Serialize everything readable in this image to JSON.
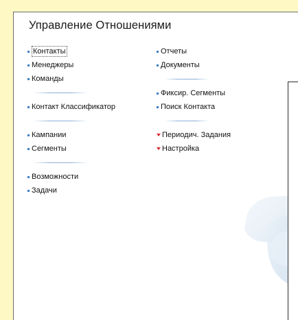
{
  "panel": {
    "title": "Управление Отношениями"
  },
  "left_column": {
    "group1": [
      "Контакты",
      "Менеджеры",
      "Команды"
    ],
    "group2": [
      "Контакт Классификатор"
    ],
    "group3": [
      "Кампании",
      "Сегменты"
    ],
    "group4": [
      "Возможности",
      "Задачи"
    ]
  },
  "right_column": {
    "group1": [
      "Отчеты",
      "Документы"
    ],
    "group2": [
      "Фиксир. Сегменты",
      "Поиск Контакта"
    ],
    "group3": [
      "Периодич. Задания",
      "Настройка"
    ]
  },
  "colors": {
    "background": "#fdf8c4",
    "bullet": "#3f7fc6",
    "arrow": "#d9262a",
    "separator": "#8cafd7"
  }
}
